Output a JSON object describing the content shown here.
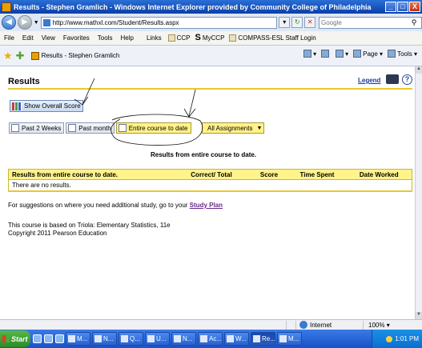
{
  "window": {
    "title": "Results - Stephen Gramlich - Windows Internet Explorer provided by Community College of Philadelphia",
    "min": "_",
    "max": "□",
    "close": "X"
  },
  "address": {
    "url": "http://www.mathxl.com/Student/Results.aspx",
    "search_placeholder": "Google"
  },
  "menu": {
    "items": [
      "File",
      "Edit",
      "View",
      "Favorites",
      "Tools",
      "Help"
    ],
    "links_label": "Links",
    "links": [
      "CCP",
      "MyCCP",
      "COMPASS-ESL Staff Login"
    ],
    "links_s_glyph": "S"
  },
  "favorites": {
    "tab_title": "Results - Stephen Gramlich",
    "page_label": "Page",
    "tools_label": "Tools"
  },
  "page": {
    "title": "Results",
    "legend_label": "Legend",
    "help_glyph": "?",
    "overall_score_label": "Show Overall Score",
    "tabs": [
      "Past 2 Weeks",
      "Past month",
      "Entire course to date"
    ],
    "assignments_select": "All Assignments",
    "results_caption": "Results from entire course to date.",
    "table": {
      "headers": [
        "Results from entire course to date.",
        "Correct/ Total",
        "Score",
        "Time Spent",
        "Date Worked"
      ],
      "empty_message": "There are no results."
    },
    "suggestion_text": "For suggestions on where you need additional study, go to your",
    "study_plan_link": "Study Plan",
    "course_line1": "This course is based on Triola: Elementary Statistics, 11e",
    "course_line2": "Copyright 2011 Pearson Education"
  },
  "status": {
    "zone": "Internet",
    "zoom": "100%"
  },
  "taskbar": {
    "start_label": "Start",
    "tasks": [
      "M...",
      "N...",
      "Q...",
      "U...",
      "N...",
      "Ac...",
      "W...",
      "Re...",
      "M..."
    ],
    "active_task_index": 7,
    "clock": "1:01 PM"
  }
}
